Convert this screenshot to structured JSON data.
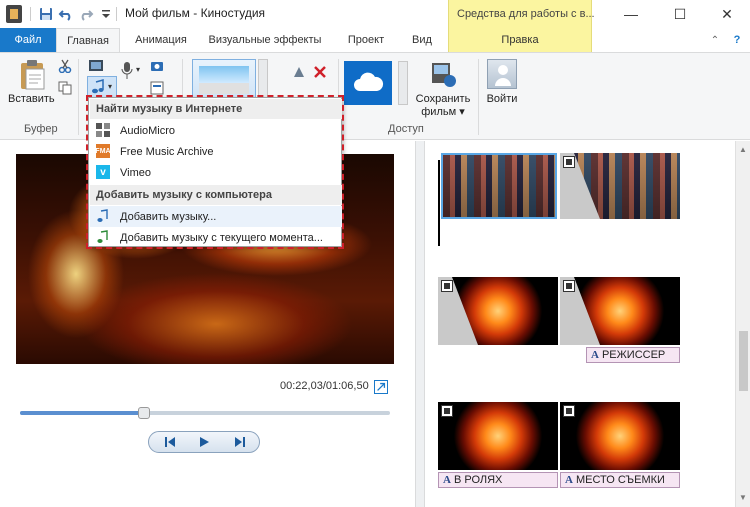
{
  "window": {
    "title": "Мой фильм - Киностудия",
    "contextual_title": "Средства для работы с в...",
    "minimize": "—",
    "maximize": "☐",
    "close": "✕"
  },
  "tabs": {
    "file": "Файл",
    "items": [
      {
        "label": "Главная"
      },
      {
        "label": "Анимация"
      },
      {
        "label": "Визуальные эффекты"
      },
      {
        "label": "Проект"
      },
      {
        "label": "Вид"
      },
      {
        "label": "Правка"
      }
    ],
    "collapse": "⌃",
    "help": "?"
  },
  "ribbon": {
    "paste_label": "Вставить",
    "clipboard_group": "Буфер",
    "access_group": "Доступ",
    "save_movie_label_1": "Сохранить",
    "save_movie_label_2": "фильм ▾",
    "signin_label": "Войти"
  },
  "music_menu": {
    "header_online": "Найти музыку в Интернете",
    "online_items": [
      {
        "label": "AudioMicro",
        "icon": "audiomicro-icon"
      },
      {
        "label": "Free Music Archive",
        "icon": "fma-icon"
      },
      {
        "label": "Vimeo",
        "icon": "vimeo-icon"
      }
    ],
    "header_local": "Добавить музыку с компьютера",
    "local_items": [
      {
        "label": "Добавить музыку..."
      },
      {
        "label": "Добавить музыку с текущего момента..."
      }
    ]
  },
  "player": {
    "time": "00:22,03/01:06,50",
    "progress": 0.335
  },
  "storyboard": {
    "captions": [
      {
        "label": "РЕЖИССЕР"
      },
      {
        "label": "В РОЛЯХ"
      },
      {
        "label": "МЕСТО СЪЕМКИ"
      }
    ],
    "caption_glyph": "A"
  },
  "colors": {
    "accent": "#1979ca",
    "contextual": "#fbf5a0",
    "highlight_frame": "#d0202a"
  }
}
